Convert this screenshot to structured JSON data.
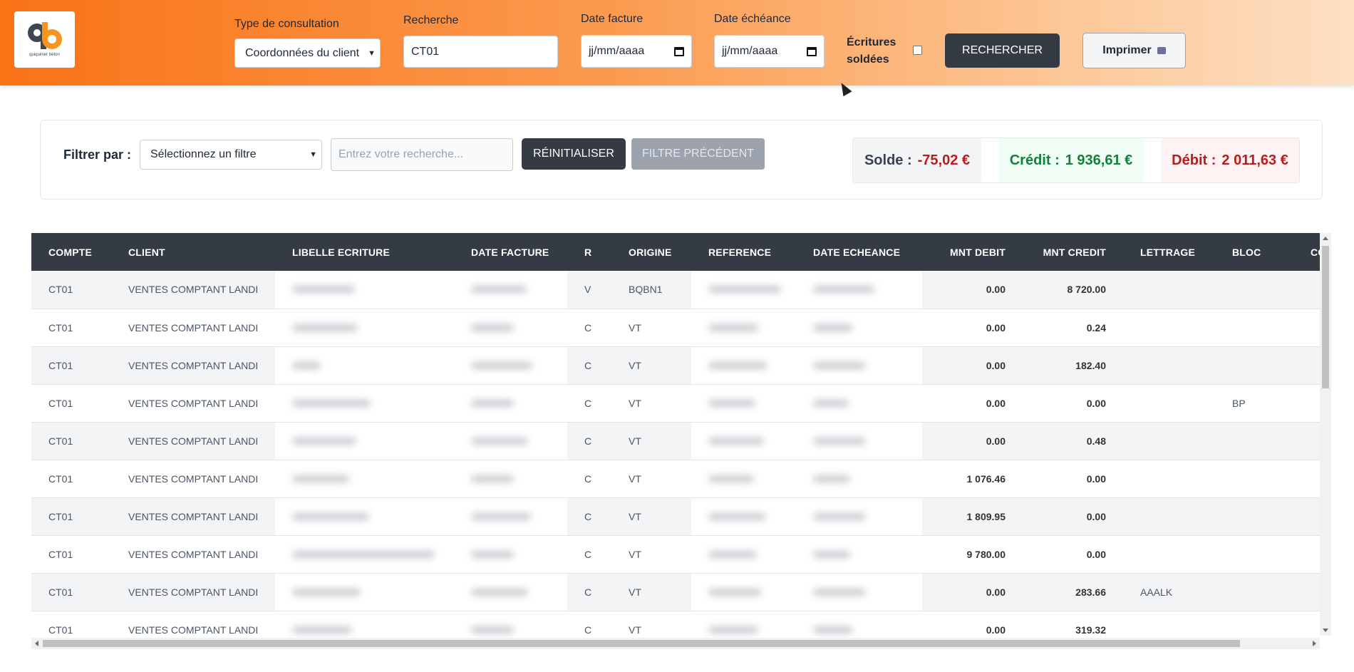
{
  "header": {
    "logo_text": "quiquinier béton",
    "type_consultation": {
      "label": "Type de consultation",
      "value": "Coordonnées du client"
    },
    "recherche": {
      "label": "Recherche",
      "value": "CT01"
    },
    "date_facture": {
      "label": "Date facture",
      "value": "jj/mm/aaaa"
    },
    "date_echeance": {
      "label": "Date échéance",
      "value": "jj/mm/aaaa"
    },
    "ecritures_soldees": {
      "label_line1": "Écritures",
      "label_line2": "soldées",
      "checked": false
    },
    "search_button": "RECHERCHER",
    "print_button": "Imprimer"
  },
  "filter": {
    "label": "Filtrer par :",
    "select_value": "Sélectionnez un filtre",
    "input_placeholder": "Entrez votre recherche...",
    "reset_button": "RÉINITIALISER",
    "previous_button": "FILTRE PRÉCÉDENT"
  },
  "summary": {
    "solde": {
      "label": "Solde :",
      "value": "-75,02 €",
      "color": "#b91c1c",
      "bg": "#f3f4f6"
    },
    "credit": {
      "label": "Crédit :",
      "value": "1 936,61 €",
      "color": "#15803d",
      "bg": "#f0fdf4"
    },
    "debit": {
      "label": "Débit :",
      "value": "2 011,63 €",
      "color": "#b91c1c",
      "bg": "#fef2f2"
    }
  },
  "table": {
    "columns": [
      "COMPTE",
      "CLIENT",
      "LIBELLE ECRITURE",
      "DATE FACTURE",
      "R",
      "ORIGINE",
      "REFERENCE",
      "DATE ECHEANCE",
      "MNT DEBIT",
      "MNT CREDIT",
      "LETTRAGE",
      "BLOC",
      "COMM"
    ],
    "rows": [
      {
        "compte": "CT01",
        "client": "VENTES COMPTANT LANDI",
        "r": "V",
        "origine": "BQBN1",
        "debit": "0.00",
        "credit": "8 720.00",
        "lettrage": "",
        "bloc": ""
      },
      {
        "compte": "CT01",
        "client": "VENTES COMPTANT LANDI",
        "r": "C",
        "origine": "VT",
        "debit": "0.00",
        "credit": "0.24",
        "lettrage": "",
        "bloc": ""
      },
      {
        "compte": "CT01",
        "client": "VENTES COMPTANT LANDI",
        "r": "C",
        "origine": "VT",
        "debit": "0.00",
        "credit": "182.40",
        "lettrage": "",
        "bloc": ""
      },
      {
        "compte": "CT01",
        "client": "VENTES COMPTANT LANDI",
        "r": "C",
        "origine": "VT",
        "debit": "0.00",
        "credit": "0.00",
        "lettrage": "",
        "bloc": "BP"
      },
      {
        "compte": "CT01",
        "client": "VENTES COMPTANT LANDI",
        "r": "C",
        "origine": "VT",
        "debit": "0.00",
        "credit": "0.48",
        "lettrage": "",
        "bloc": ""
      },
      {
        "compte": "CT01",
        "client": "VENTES COMPTANT LANDI",
        "r": "C",
        "origine": "VT",
        "debit": "1 076.46",
        "credit": "0.00",
        "lettrage": "",
        "bloc": ""
      },
      {
        "compte": "CT01",
        "client": "VENTES COMPTANT LANDI",
        "r": "C",
        "origine": "VT",
        "debit": "1 809.95",
        "credit": "0.00",
        "lettrage": "",
        "bloc": ""
      },
      {
        "compte": "CT01",
        "client": "VENTES COMPTANT LANDI",
        "r": "C",
        "origine": "VT",
        "debit": "9 780.00",
        "credit": "0.00",
        "lettrage": "",
        "bloc": ""
      },
      {
        "compte": "CT01",
        "client": "VENTES COMPTANT LANDI",
        "r": "C",
        "origine": "VT",
        "debit": "0.00",
        "credit": "283.66",
        "lettrage": "AAALK",
        "bloc": ""
      },
      {
        "compte": "CT01",
        "client": "VENTES COMPTANT LANDI",
        "r": "C",
        "origine": "VT",
        "debit": "0.00",
        "credit": "319.32",
        "lettrage": "",
        "bloc": ""
      }
    ]
  }
}
